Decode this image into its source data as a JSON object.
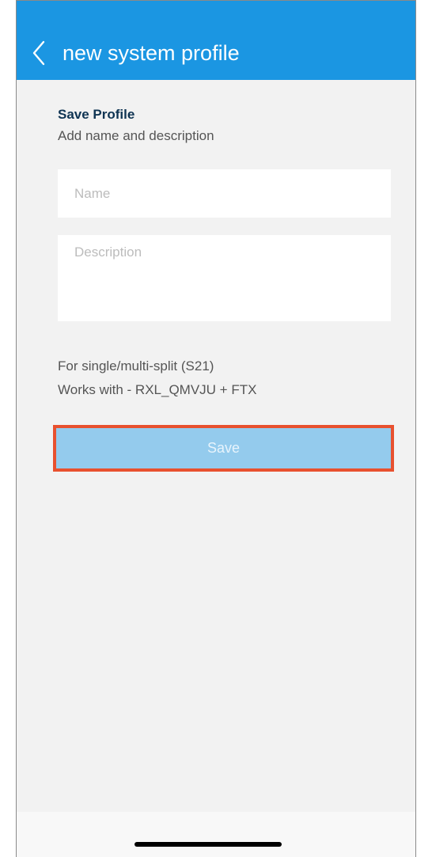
{
  "header": {
    "title": "new system profile",
    "back_icon": "chevron-left-icon",
    "color": "#1b96e2"
  },
  "form": {
    "title": "Save Profile",
    "subtitle": "Add name and description",
    "name_placeholder": "Name",
    "name_value": "",
    "description_placeholder": "Description",
    "description_value": ""
  },
  "info": {
    "line1": "For single/multi-split (S21)",
    "line2": "Works with - RXL_QMVJU + FTX"
  },
  "actions": {
    "save_label": "Save",
    "highlight_color": "#e8512f"
  }
}
